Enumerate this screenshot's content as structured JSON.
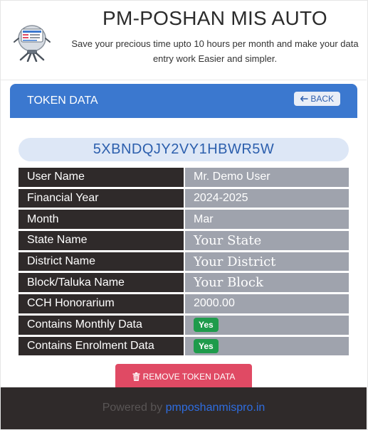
{
  "header": {
    "title": "PM-POSHAN MIS AUTO",
    "tagline": "Save your precious time upto 10 hours per month and make your data entry work Easier and simpler."
  },
  "card": {
    "title": "TOKEN DATA",
    "back_label": "BACK",
    "back_icon": "arrow-left-icon",
    "token": "5XBNDQJY2VY1HBWR5W",
    "rows": [
      {
        "label": "User Name",
        "value": "Mr. Demo User"
      },
      {
        "label": "Financial Year",
        "value": "2024-2025"
      },
      {
        "label": "Month",
        "value": "Mar"
      },
      {
        "label": "State Name",
        "value": "Your State"
      },
      {
        "label": "District Name",
        "value": "Your District"
      },
      {
        "label": "Block/Taluka Name",
        "value": "Your Block"
      },
      {
        "label": "CCH Honorarium",
        "value": "2000.00"
      },
      {
        "label": "Contains Monthly Data",
        "value": "Yes"
      },
      {
        "label": "Contains Enrolment Data",
        "value": "Yes"
      }
    ],
    "remove_label": "REMOVE TOKEN DATA",
    "remove_icon": "trash-icon"
  },
  "footer": {
    "powered_by": "Powered by",
    "link_text": "pmposhanmispro.in"
  },
  "colors": {
    "header_blue": "#3b78cf",
    "label_bg": "#2f2a2a",
    "value_bg": "#9fa3ad",
    "badge_green": "#1e9b4b",
    "remove_red": "#e04a64",
    "link_blue": "#2f6de0"
  }
}
